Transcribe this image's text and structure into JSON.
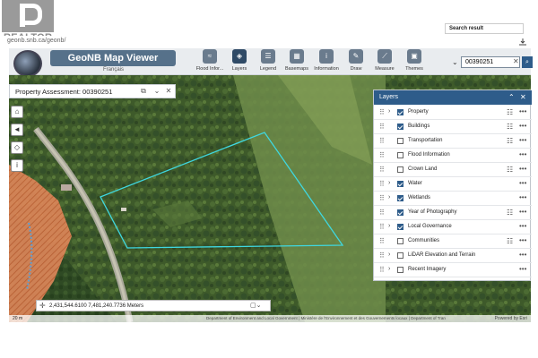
{
  "watermark": {
    "text": "REALTOR"
  },
  "browser": {
    "url": "geonb.snb.ca/geonb/",
    "download_icon": "download-icon"
  },
  "header": {
    "title": "GeoNB Map Viewer",
    "language_link": "Français",
    "tools": [
      {
        "label": "Flood Infor...",
        "icon": "flood-icon"
      },
      {
        "label": "Layers",
        "icon": "layers-icon",
        "active": true
      },
      {
        "label": "Legend",
        "icon": "legend-icon"
      },
      {
        "label": "Basemaps",
        "icon": "basemaps-icon"
      },
      {
        "label": "Information",
        "icon": "info-icon"
      },
      {
        "label": "Draw",
        "icon": "draw-icon"
      },
      {
        "label": "Measure",
        "icon": "measure-icon"
      },
      {
        "label": "Themes",
        "icon": "themes-icon"
      }
    ],
    "search": {
      "value": "00390251",
      "placeholder": "",
      "result_label": "Search result"
    }
  },
  "property_panel": {
    "title": "Property Assessment: 00390251"
  },
  "map_tools": [
    "home-icon",
    "back-icon",
    "locate-icon",
    "info-icon"
  ],
  "layers_panel": {
    "title": "Layers",
    "rows": [
      {
        "label": "Property",
        "checked": true,
        "expandable": true
      },
      {
        "label": "Buildings",
        "checked": true,
        "expandable": false
      },
      {
        "label": "Transportation",
        "checked": false,
        "expandable": false
      },
      {
        "label": "Flood Information",
        "checked": false,
        "expandable": false
      },
      {
        "label": "Crown Land",
        "checked": false,
        "expandable": false
      },
      {
        "label": "Water",
        "checked": true,
        "expandable": true
      },
      {
        "label": "Wetlands",
        "checked": true,
        "expandable": true
      },
      {
        "label": "Year of Photography",
        "checked": true,
        "expandable": false
      },
      {
        "label": "Local Governance",
        "checked": true,
        "expandable": true
      },
      {
        "label": "Communities",
        "checked": false,
        "expandable": false
      },
      {
        "label": "LiDAR Elevation and Terrain",
        "checked": false,
        "expandable": true
      },
      {
        "label": "Recent Imagery",
        "checked": false,
        "expandable": true
      }
    ]
  },
  "coordinates": {
    "text": "2,431,544.6100 7,481,240.7736 Meters"
  },
  "footer": {
    "scale": "20 m",
    "attribution": "Department of Environment and Local Government | Ministère de l'Environnement et des Gouvernements locaux | Department of Tran",
    "powered": "Powered by Esri"
  },
  "colors": {
    "accent": "#2e5c8a",
    "parcel_outline": "#3fd8e0",
    "title_bar": "#56718a"
  }
}
